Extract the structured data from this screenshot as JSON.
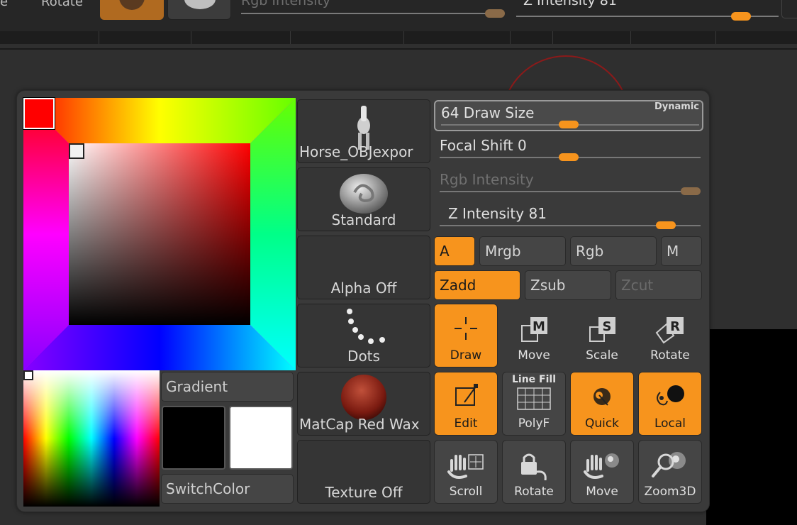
{
  "topbar": {
    "left_label_partial": "e",
    "rotate_label": "Rotate",
    "rgb_intensity_label": "Rgb Intensity",
    "z_intensity_label": "Z Intensity 81"
  },
  "color": {
    "current": "#ff0000",
    "main_colors": [
      "#000000",
      "#ffffff"
    ],
    "gradient_label": "Gradient",
    "switch_label": "SwitchColor"
  },
  "materials": [
    {
      "label": "Horse_OBJexpor",
      "icon": "horse-figure-icon"
    },
    {
      "label": "Standard",
      "icon": "standard-brush-icon"
    },
    {
      "label": "Alpha Off",
      "icon": "alpha-off-icon"
    },
    {
      "label": "Dots",
      "icon": "dots-stroke-icon"
    },
    {
      "label": "MatCap Red Wax",
      "icon": "red-wax-sphere-icon"
    },
    {
      "label": "Texture Off",
      "icon": "texture-off-icon"
    }
  ],
  "sliders": {
    "draw_size": {
      "label": "64 Draw Size",
      "value": 64,
      "badge": "Dynamic"
    },
    "focal_shift": {
      "label": "Focal Shift 0",
      "value": 0
    },
    "rgb_intensity": {
      "label": "Rgb Intensity",
      "enabled": false
    },
    "z_intensity": {
      "label": "Z Intensity 81",
      "value": 81
    }
  },
  "toggles_row1": [
    {
      "label": "A",
      "active": true
    },
    {
      "label": "Mrgb",
      "active": false
    },
    {
      "label": "Rgb",
      "active": false
    },
    {
      "label": "M",
      "active": false
    }
  ],
  "toggles_row2": [
    {
      "label": "Zadd",
      "active": true
    },
    {
      "label": "Zsub",
      "active": false
    },
    {
      "label": "Zcut",
      "active": false,
      "disabled": true
    }
  ],
  "tools_row1": [
    {
      "label": "Draw",
      "icon": "draw-crosshair-icon",
      "active": true
    },
    {
      "label": "Move",
      "icon": "move-m-icon",
      "active": false
    },
    {
      "label": "Scale",
      "icon": "scale-s-icon",
      "active": false
    },
    {
      "label": "Rotate",
      "icon": "rotate-r-icon",
      "active": false
    }
  ],
  "tools_row2": [
    {
      "label": "Edit",
      "icon": "edit-frame-icon",
      "active": true
    },
    {
      "label": "PolyF",
      "top_label": "Line Fill",
      "icon": "polyframe-grid-icon",
      "active": false
    },
    {
      "label": "Quick",
      "icon": "quick-sketch-icon",
      "active": true
    },
    {
      "label": "Local",
      "icon": "local-symmetry-icon",
      "active": true
    }
  ],
  "tools_row3": [
    {
      "label": "Scroll",
      "icon": "scroll-hand-icon"
    },
    {
      "label": "Rotate",
      "icon": "rotate-lock-icon"
    },
    {
      "label": "Move",
      "icon": "move-hand-icon"
    },
    {
      "label": "Zoom3D",
      "icon": "zoom3d-magnifier-icon"
    }
  ],
  "colors": {
    "accent": "#f7941d",
    "panel": "#3a3a3a",
    "button": "#454545"
  }
}
